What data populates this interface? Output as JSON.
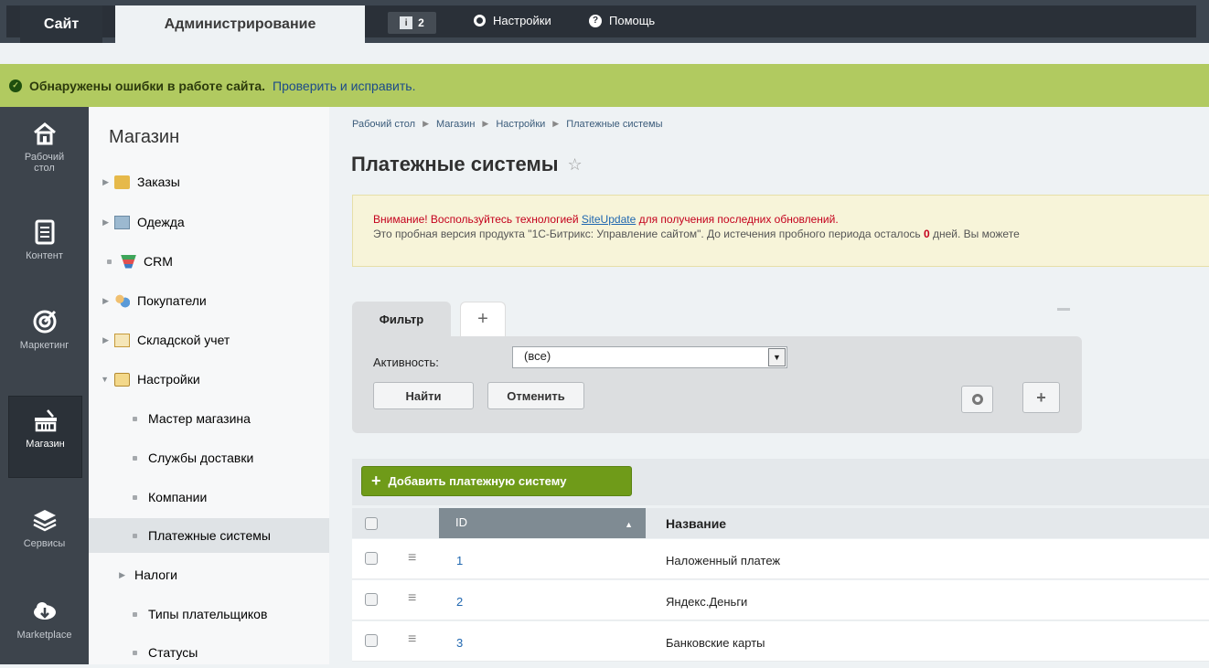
{
  "topbar": {
    "tab_site": "Сайт",
    "tab_admin": "Администрирование",
    "notifications_count": "2",
    "settings_label": "Настройки",
    "help_label": "Помощь"
  },
  "alert": {
    "message": "Обнаружены ошибки в работе сайта.",
    "link": "Проверить и исправить."
  },
  "leftnav": {
    "items": [
      {
        "label": "Рабочий стол",
        "icon": "home-icon"
      },
      {
        "label": "Контент",
        "icon": "document-icon"
      },
      {
        "label": "Маркетинг",
        "icon": "target-icon"
      },
      {
        "label": "Магазин",
        "icon": "basket-icon",
        "active": true
      },
      {
        "label": "Сервисы",
        "icon": "layers-icon"
      },
      {
        "label": "Marketplace",
        "icon": "cloud-download-icon"
      }
    ]
  },
  "submenu": {
    "title": "Магазин",
    "items": [
      {
        "label": "Заказы"
      },
      {
        "label": "Одежда"
      },
      {
        "label": "CRM"
      },
      {
        "label": "Покупатели"
      },
      {
        "label": "Складской учет"
      },
      {
        "label": "Настройки"
      },
      {
        "label": "Мастер магазина"
      },
      {
        "label": "Службы доставки"
      },
      {
        "label": "Компании"
      },
      {
        "label": "Платежные системы"
      },
      {
        "label": "Налоги"
      },
      {
        "label": "Типы плательщиков"
      },
      {
        "label": "Статусы"
      }
    ]
  },
  "breadcrumb": [
    "Рабочий стол",
    "Магазин",
    "Настройки",
    "Платежные системы"
  ],
  "page_title": "Платежные системы",
  "warning": {
    "line1_prefix": "Внимание! Воспользуйтесь технологией ",
    "line1_link": "SiteUpdate",
    "line1_suffix": " для получения последних обновлений.",
    "line2_prefix": "Это пробная версия продукта \"1С-Битрикс: Управление сайтом\". До истечения пробного периода осталось ",
    "line2_days": "0",
    "line2_suffix": " дней. Вы можете"
  },
  "filter": {
    "tab_label": "Фильтр",
    "activity_label": "Активность:",
    "activity_value": "(все)",
    "find_button": "Найти",
    "cancel_button": "Отменить"
  },
  "toolbar": {
    "add_button": "Добавить платежную систему"
  },
  "table": {
    "columns": {
      "id": "ID",
      "name": "Название"
    },
    "rows": [
      {
        "id": "1",
        "name": "Наложенный платеж"
      },
      {
        "id": "2",
        "name": "Яндекс.Деньги"
      },
      {
        "id": "3",
        "name": "Банковские карты"
      }
    ]
  },
  "colors": {
    "alert_green": "#b1ca60",
    "add_button_green": "#6f9b19",
    "topbar_dark": "#2a3038"
  }
}
